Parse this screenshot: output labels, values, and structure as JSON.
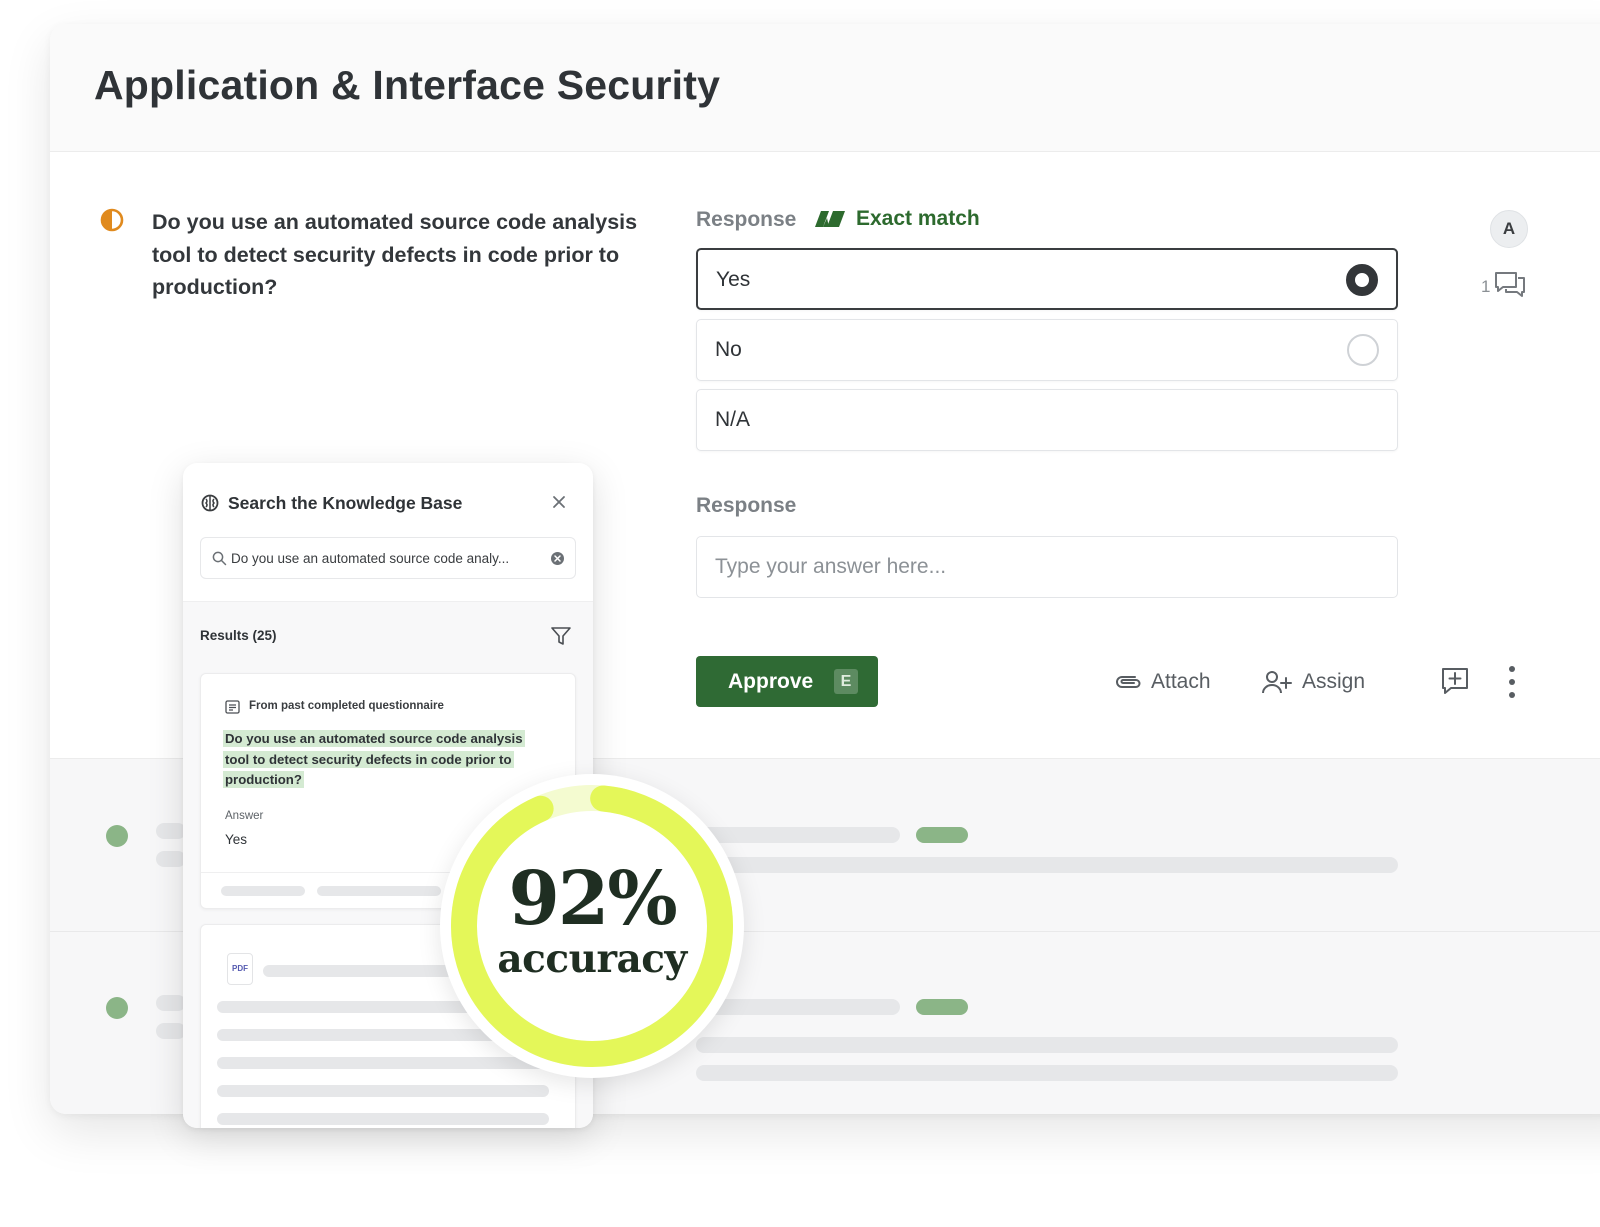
{
  "header": {
    "title": "Application & Interface Security"
  },
  "question": {
    "text": "Do you use an automated source code analysis tool to detect security defects in code prior to production?",
    "status_icon": "half-circle-icon"
  },
  "response": {
    "label": "Response",
    "match_label": "Exact match",
    "options": [
      {
        "label": "Yes",
        "selected": true
      },
      {
        "label": "No",
        "selected": false
      },
      {
        "label": "N/A",
        "selected": false
      }
    ],
    "free_text_label": "Response",
    "free_text_placeholder": "Type your answer here..."
  },
  "actions": {
    "approve_label": "Approve",
    "approve_shortcut": "E",
    "attach_label": "Attach",
    "assign_label": "Assign"
  },
  "side": {
    "avatar_initial": "A",
    "comment_count": "1"
  },
  "knowledge_base": {
    "title": "Search the Knowledge Base",
    "search_value": "Do you use an automated source code analy...",
    "results_label": "Results (25)",
    "result": {
      "source": "From past completed questionnaire",
      "question_lines": [
        "Do you use an automated source code analysis",
        "tool to detect security defects in code prior to",
        "production?"
      ],
      "answer_label": "Answer",
      "answer": "Yes"
    },
    "pdf_label": "PDF"
  },
  "accuracy": {
    "value": "92%",
    "word": "accuracy",
    "fraction": 0.92
  },
  "colors": {
    "brand_green": "#2f6a34",
    "match_green": "#2d6a2e",
    "accent_lime": "#e4f759",
    "status_orange": "#e08a1e",
    "row_dot": "#8bb587"
  }
}
